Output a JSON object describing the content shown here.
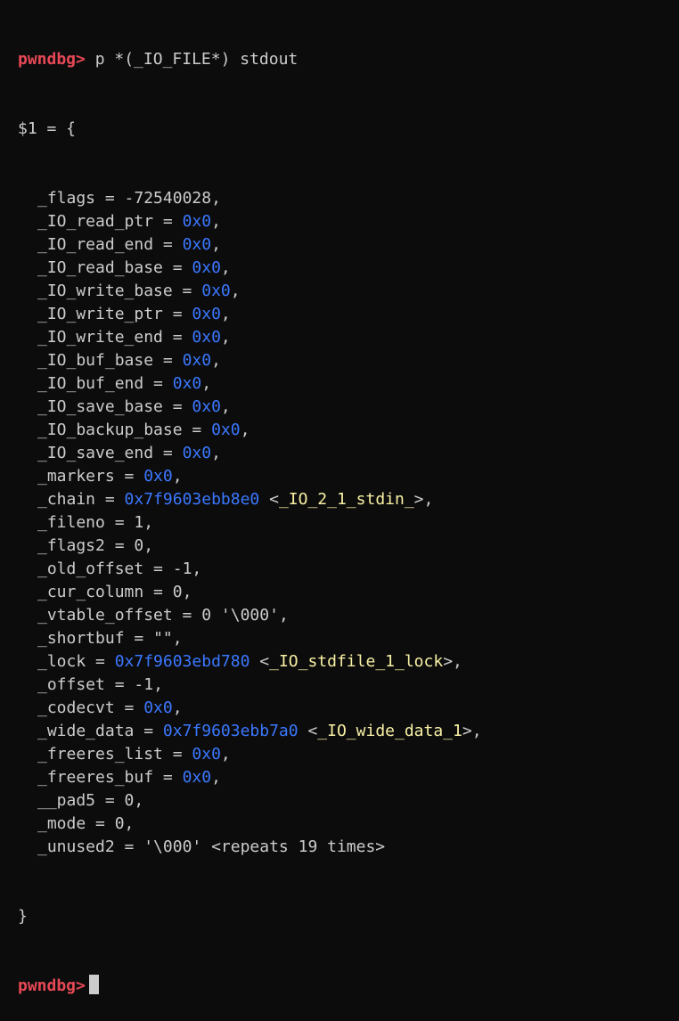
{
  "prompt": {
    "label": "pwndbg>",
    "command": " p *(_IO_FILE*) stdout"
  },
  "result_open": "$1 = {",
  "fields": [
    {
      "name": "_flags",
      "value": "-72540028",
      "kind": "num"
    },
    {
      "name": "_IO_read_ptr",
      "value": "0x0",
      "kind": "hex"
    },
    {
      "name": "_IO_read_end",
      "value": "0x0",
      "kind": "hex"
    },
    {
      "name": "_IO_read_base",
      "value": "0x0",
      "kind": "hex"
    },
    {
      "name": "_IO_write_base",
      "value": "0x0",
      "kind": "hex"
    },
    {
      "name": "_IO_write_ptr",
      "value": "0x0",
      "kind": "hex"
    },
    {
      "name": "_IO_write_end",
      "value": "0x0",
      "kind": "hex"
    },
    {
      "name": "_IO_buf_base",
      "value": "0x0",
      "kind": "hex"
    },
    {
      "name": "_IO_buf_end",
      "value": "0x0",
      "kind": "hex"
    },
    {
      "name": "_IO_save_base",
      "value": "0x0",
      "kind": "hex"
    },
    {
      "name": "_IO_backup_base",
      "value": "0x0",
      "kind": "hex"
    },
    {
      "name": "_IO_save_end",
      "value": "0x0",
      "kind": "hex"
    },
    {
      "name": "_markers",
      "value": "0x0",
      "kind": "hex"
    },
    {
      "name": "_chain",
      "value": "0x7f9603ebb8e0",
      "kind": "hex",
      "symbol": "_IO_2_1_stdin_"
    },
    {
      "name": "_fileno",
      "value": "1",
      "kind": "num"
    },
    {
      "name": "_flags2",
      "value": "0",
      "kind": "num"
    },
    {
      "name": "_old_offset",
      "value": "-1",
      "kind": "num"
    },
    {
      "name": "_cur_column",
      "value": "0",
      "kind": "num"
    },
    {
      "name": "_vtable_offset",
      "value": "0 '\\000'",
      "kind": "num"
    },
    {
      "name": "_shortbuf",
      "value": "\"\"",
      "kind": "num"
    },
    {
      "name": "_lock",
      "value": "0x7f9603ebd780",
      "kind": "hex",
      "symbol": "_IO_stdfile_1_lock"
    },
    {
      "name": "_offset",
      "value": "-1",
      "kind": "num"
    },
    {
      "name": "_codecvt",
      "value": "0x0",
      "kind": "hex"
    },
    {
      "name": "_wide_data",
      "value": "0x7f9603ebb7a0",
      "kind": "hex",
      "symbol": "_IO_wide_data_1"
    },
    {
      "name": "_freeres_list",
      "value": "0x0",
      "kind": "hex"
    },
    {
      "name": "_freeres_buf",
      "value": "0x0",
      "kind": "hex"
    },
    {
      "name": "__pad5",
      "value": "0",
      "kind": "num"
    },
    {
      "name": "_mode",
      "value": "0",
      "kind": "num"
    },
    {
      "name": "_unused2",
      "value": "'\\000' <repeats 19 times>",
      "kind": "num",
      "last": true
    }
  ],
  "result_close": "}",
  "next_prompt": {
    "label": "pwndbg>"
  },
  "colors": {
    "background": "#0c0c0c",
    "text": "#cccccc",
    "prompt": "#e74856",
    "hex": "#3b78ff",
    "symbol": "#f9f1a5"
  }
}
